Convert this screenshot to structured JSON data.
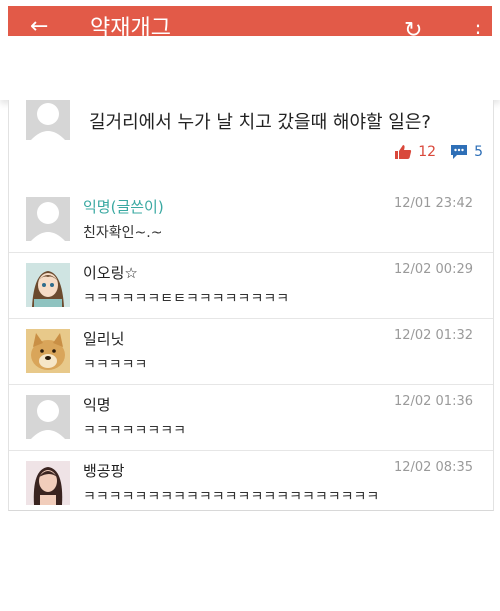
{
  "appbar": {
    "title": "약재개그",
    "back_icon": "←",
    "refresh_icon": "↻",
    "menu_icon": "⋮",
    "color": "#e25a48"
  },
  "post": {
    "text": "길거리에서 누가 날 치고 갔을때 해야할 일은?",
    "likes": "12",
    "comments": "5",
    "like_color": "#d9483b",
    "comment_color": "#2e6fb7"
  },
  "comments": [
    {
      "name": "익명(글쓴이)",
      "time": "12/01 23:42",
      "text": "친자확인~.~",
      "avatar": "default",
      "is_author": true
    },
    {
      "name": "이오링☆",
      "time": "12/02 00:29",
      "text": "ㅋㅋㅋㅋㅋㅋㅌㅌㅋㅋㅋㅋㅋㅋㅋㅋ",
      "avatar": "anime-girl"
    },
    {
      "name": "일리닛",
      "time": "12/02 01:32",
      "text": "ㅋㅋㅋㅋㅋ",
      "avatar": "doge"
    },
    {
      "name": "익명",
      "time": "12/02 01:36",
      "text": "ㅋㅋㅋㅋㅋㅋㅋㅋ",
      "avatar": "default"
    },
    {
      "name": "뱅공팡",
      "time": "12/02 08:35",
      "text": "ㅋㅋㅋㅋㅋㅋㅋㅋㅋㅋㅋㅋㅋㅋㅋㅋㅋㅋㅋㅋㅋㅋㅋ",
      "avatar": "woman-photo"
    }
  ]
}
